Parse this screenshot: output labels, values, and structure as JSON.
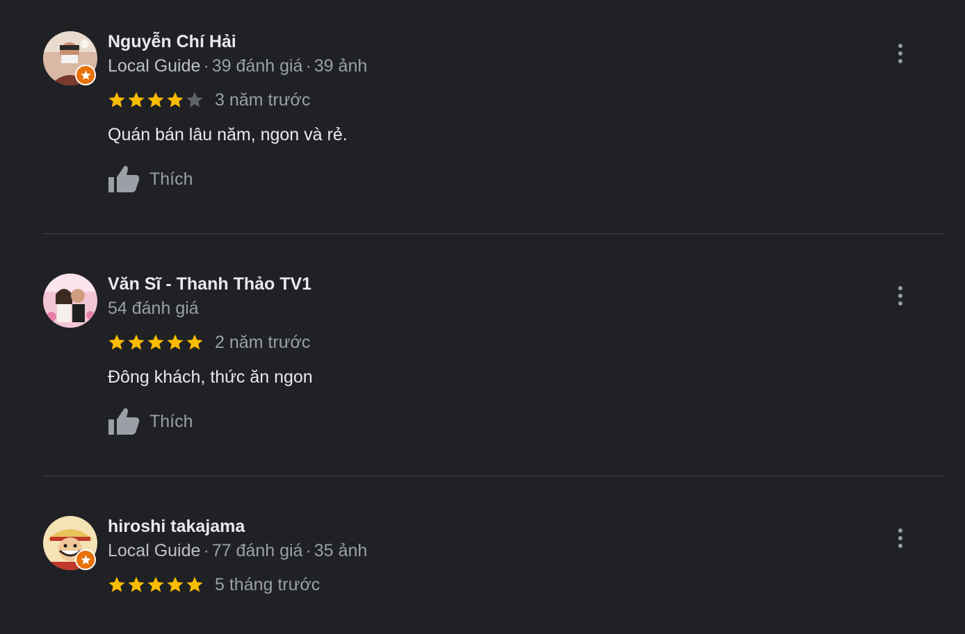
{
  "colors": {
    "background": "#202124",
    "star_filled": "#fbbc04",
    "star_empty": "#5f6368",
    "local_guide_badge": "#e8710a"
  },
  "like_icon": "thumb-up-icon",
  "more_icon": "more-vertical-icon",
  "reviews": [
    {
      "name": "Nguyễn Chí Hải",
      "local_guide": "Local Guide",
      "is_local_guide": true,
      "review_count": "39 đánh giá",
      "photo_count": "39 ảnh",
      "rating": 4,
      "max_rating": 5,
      "date": "3 năm trước",
      "text": "Quán bán lâu năm, ngon và rẻ.",
      "like_label": "Thích"
    },
    {
      "name": "Văn Sĩ - Thanh Thảo TV1",
      "local_guide": "",
      "is_local_guide": false,
      "review_count": "54 đánh giá",
      "photo_count": "",
      "rating": 5,
      "max_rating": 5,
      "date": "2 năm trước",
      "text": "Đông khách, thức ăn ngon",
      "like_label": "Thích"
    },
    {
      "name": "hiroshi takajama",
      "local_guide": "Local Guide",
      "is_local_guide": true,
      "review_count": "77 đánh giá",
      "photo_count": "35 ảnh",
      "rating": 5,
      "max_rating": 5,
      "date": "5 tháng trước",
      "text": "",
      "like_label": ""
    }
  ]
}
